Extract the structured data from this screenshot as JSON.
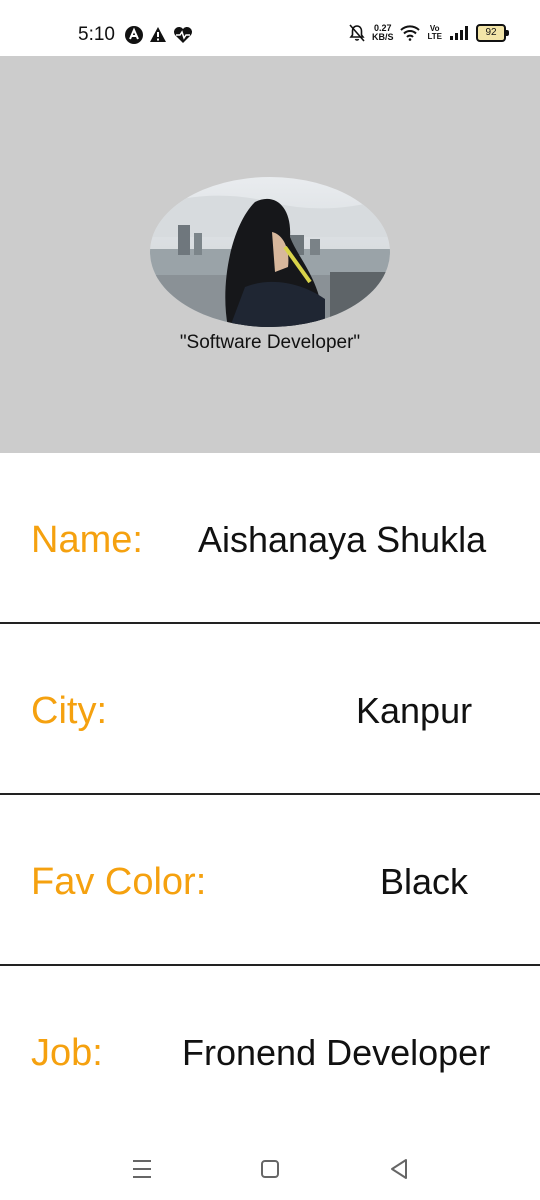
{
  "status_bar": {
    "time": "5:10",
    "net_speed_value": "0.27",
    "net_speed_unit": "KB/S",
    "volte_top": "Vo",
    "volte_bottom": "LTE",
    "battery": "92",
    "icons": [
      "app-a-icon",
      "warning-icon",
      "heart-monitor-icon",
      "mute-icon",
      "wifi-icon",
      "signal-icon"
    ]
  },
  "profile": {
    "title": "\"Software Developer\"",
    "avatar_icon": "profile-photo"
  },
  "info": [
    {
      "label": "Name:",
      "value": "Aishanaya Shukla"
    },
    {
      "label": "City:",
      "value": "Kanpur"
    },
    {
      "label": "Fav Color:",
      "value": "Black"
    },
    {
      "label": "Job:",
      "value": "Fronend Developer"
    }
  ],
  "colors": {
    "header_bg": "#cccccc",
    "label": "#f5a10f",
    "value": "#111111",
    "divider": "#222222"
  },
  "nav": {
    "icons": [
      "menu-icon",
      "home-square-icon",
      "back-triangle-icon"
    ]
  }
}
